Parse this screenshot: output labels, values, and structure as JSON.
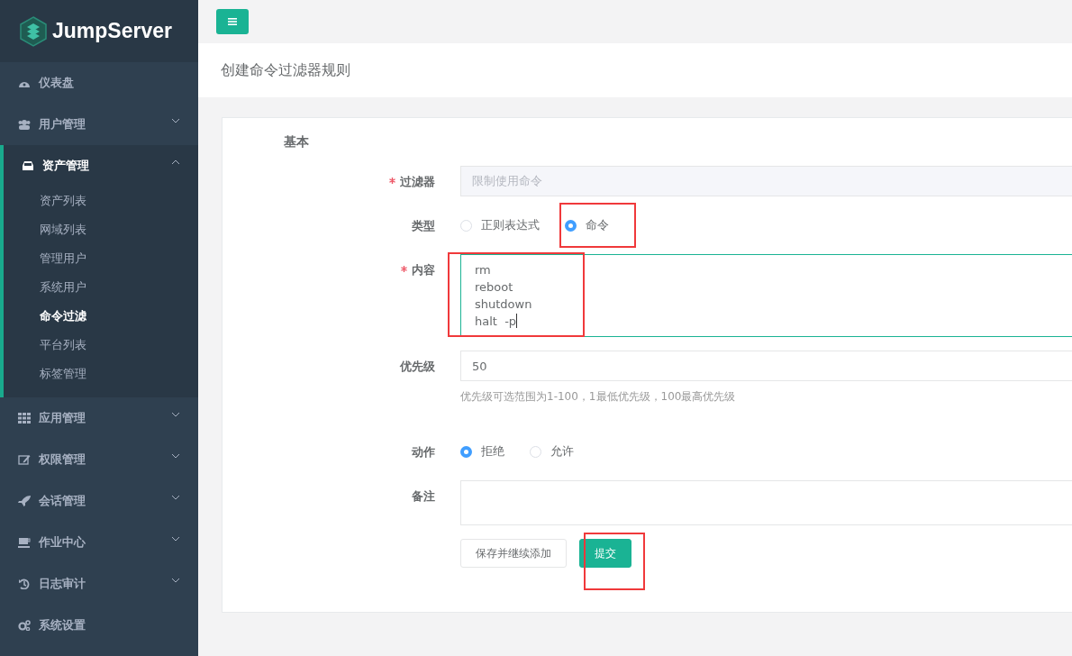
{
  "sidebar": {
    "logo": "JumpServer",
    "items": [
      {
        "label": "仪表盘",
        "kind": "link",
        "expanded": false
      },
      {
        "label": "用户管理",
        "kind": "group",
        "expanded": false
      },
      {
        "label": "资产管理",
        "kind": "group",
        "expanded": true,
        "children": [
          {
            "label": "资产列表",
            "selected": false
          },
          {
            "label": "网域列表",
            "selected": false
          },
          {
            "label": "管理用户",
            "selected": false
          },
          {
            "label": "系统用户",
            "selected": false
          },
          {
            "label": "命令过滤",
            "selected": true
          },
          {
            "label": "平台列表",
            "selected": false
          },
          {
            "label": "标签管理",
            "selected": false
          }
        ]
      },
      {
        "label": "应用管理",
        "kind": "group",
        "expanded": false
      },
      {
        "label": "权限管理",
        "kind": "group",
        "expanded": false
      },
      {
        "label": "会话管理",
        "kind": "group",
        "expanded": false
      },
      {
        "label": "作业中心",
        "kind": "group",
        "expanded": false
      },
      {
        "label": "日志审计",
        "kind": "group",
        "expanded": false
      },
      {
        "label": "系统设置",
        "kind": "link",
        "expanded": false
      }
    ]
  },
  "page_title": "创建命令过滤器规则",
  "form": {
    "section": "基本",
    "fields": [
      {
        "kind": "text",
        "label": "过滤器",
        "required": true,
        "disabled": true,
        "value": "限制使用命令"
      },
      {
        "kind": "radio",
        "label": "类型",
        "required": false,
        "options": [
          {
            "label": "正则表达式",
            "selected": false,
            "highlighted": false
          },
          {
            "label": "命令",
            "selected": true,
            "highlighted": true
          }
        ]
      },
      {
        "kind": "textarea",
        "label": "内容",
        "required": true,
        "value": "rm\nreboot\nshutdown\nhalt  -p",
        "focused": true,
        "highlighted": true
      },
      {
        "kind": "text",
        "label": "优先级",
        "required": false,
        "disabled": false,
        "value": "50",
        "help": "优先级可选范围为1-100，1最低优先级，100最高优先级"
      },
      {
        "kind": "radio",
        "label": "动作",
        "required": false,
        "options": [
          {
            "label": "拒绝",
            "selected": true,
            "highlighted": false
          },
          {
            "label": "允许",
            "selected": false,
            "highlighted": false
          }
        ]
      },
      {
        "kind": "textarea",
        "label": "备注",
        "required": false,
        "focused": false,
        "highlighted": false
      }
    ],
    "buttons": [
      {
        "label": "保存并继续添加",
        "kind": "default",
        "highlighted": false
      },
      {
        "label": "提交",
        "kind": "primary",
        "highlighted": true
      }
    ]
  }
}
